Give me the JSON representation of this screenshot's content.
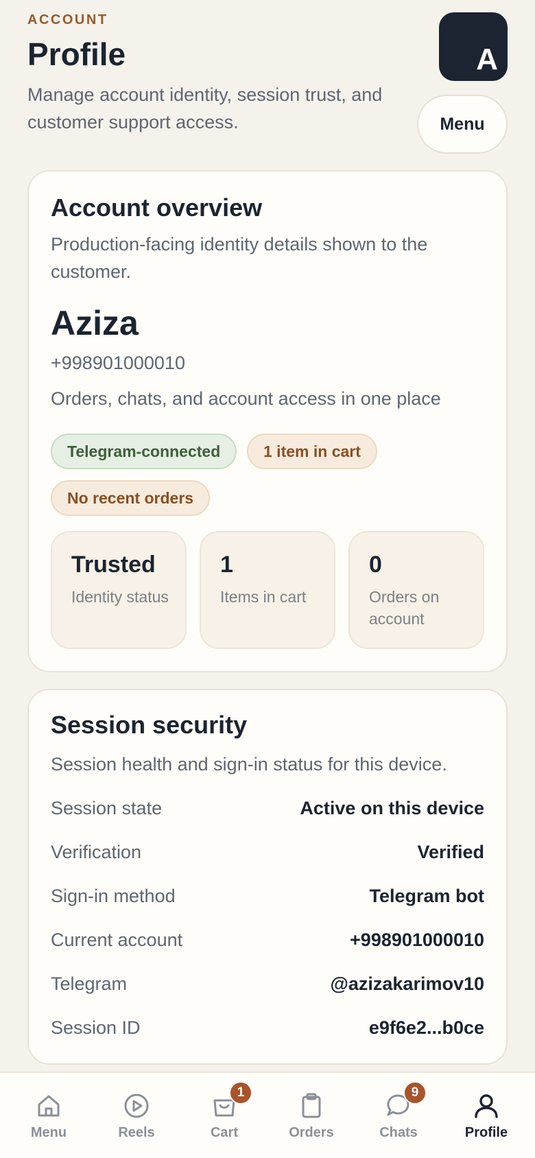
{
  "header": {
    "eyebrow": "ACCOUNT",
    "title": "Profile",
    "subtitle": "Manage account identity, session trust, and customer support access.",
    "avatar_initial": "A",
    "menu_label": "Menu"
  },
  "overview": {
    "title": "Account overview",
    "subtitle": "Production-facing identity details shown to the customer.",
    "name": "Aziza",
    "phone": "+998901000010",
    "tagline": "Orders, chats, and account access in one place",
    "chips": [
      "Telegram-connected",
      "1 item in cart",
      "No recent orders"
    ],
    "stats": [
      {
        "value": "Trusted",
        "label": "Identity status"
      },
      {
        "value": "1",
        "label": "Items in cart"
      },
      {
        "value": "0",
        "label": "Orders on account"
      }
    ]
  },
  "security": {
    "title": "Session security",
    "subtitle": "Session health and sign-in status for this device.",
    "rows": [
      {
        "label": "Session state",
        "value": "Active on this device"
      },
      {
        "label": "Verification",
        "value": "Verified"
      },
      {
        "label": "Sign-in method",
        "value": "Telegram bot"
      },
      {
        "label": "Current account",
        "value": "+998901000010"
      },
      {
        "label": "Telegram",
        "value": "@azizakarimov10"
      },
      {
        "label": "Session ID",
        "value": "e9f6e2...b0ce"
      }
    ]
  },
  "tabbar": {
    "tabs": [
      {
        "label": "Menu",
        "icon": "home-icon"
      },
      {
        "label": "Reels",
        "icon": "play-icon"
      },
      {
        "label": "Cart",
        "icon": "bag-icon",
        "badge": "1"
      },
      {
        "label": "Orders",
        "icon": "clipboard-icon"
      },
      {
        "label": "Chats",
        "icon": "chat-icon",
        "badge": "9"
      },
      {
        "label": "Profile",
        "icon": "user-icon",
        "active": true
      }
    ]
  },
  "colors": {
    "background": "#f5f2ec",
    "accent": "#9a5a2a",
    "badge": "#a9532a",
    "ink": "#1b2430"
  }
}
